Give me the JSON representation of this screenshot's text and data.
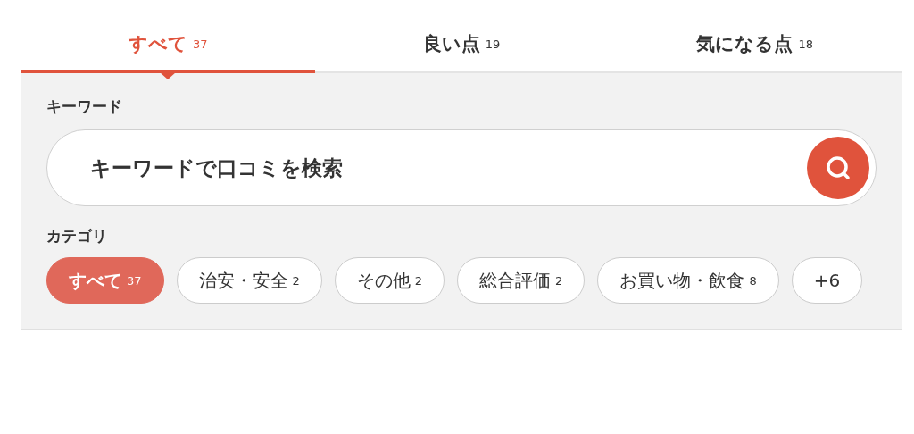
{
  "tabs": [
    {
      "label": "すべて",
      "count": "37",
      "selected": true
    },
    {
      "label": "良い点",
      "count": "19",
      "selected": false
    },
    {
      "label": "気になる点",
      "count": "18",
      "selected": false
    }
  ],
  "keyword": {
    "label": "キーワード",
    "placeholder": "キーワードで口コミを検索"
  },
  "category": {
    "label": "カテゴリ",
    "chips": [
      {
        "label": "すべて",
        "count": "37",
        "selected": true
      },
      {
        "label": "治安・安全",
        "count": "2",
        "selected": false
      },
      {
        "label": "その他",
        "count": "2",
        "selected": false
      },
      {
        "label": "総合評価",
        "count": "2",
        "selected": false
      },
      {
        "label": "お買い物・飲食",
        "count": "8",
        "selected": false
      },
      {
        "label": "+6",
        "selected": false
      }
    ]
  }
}
